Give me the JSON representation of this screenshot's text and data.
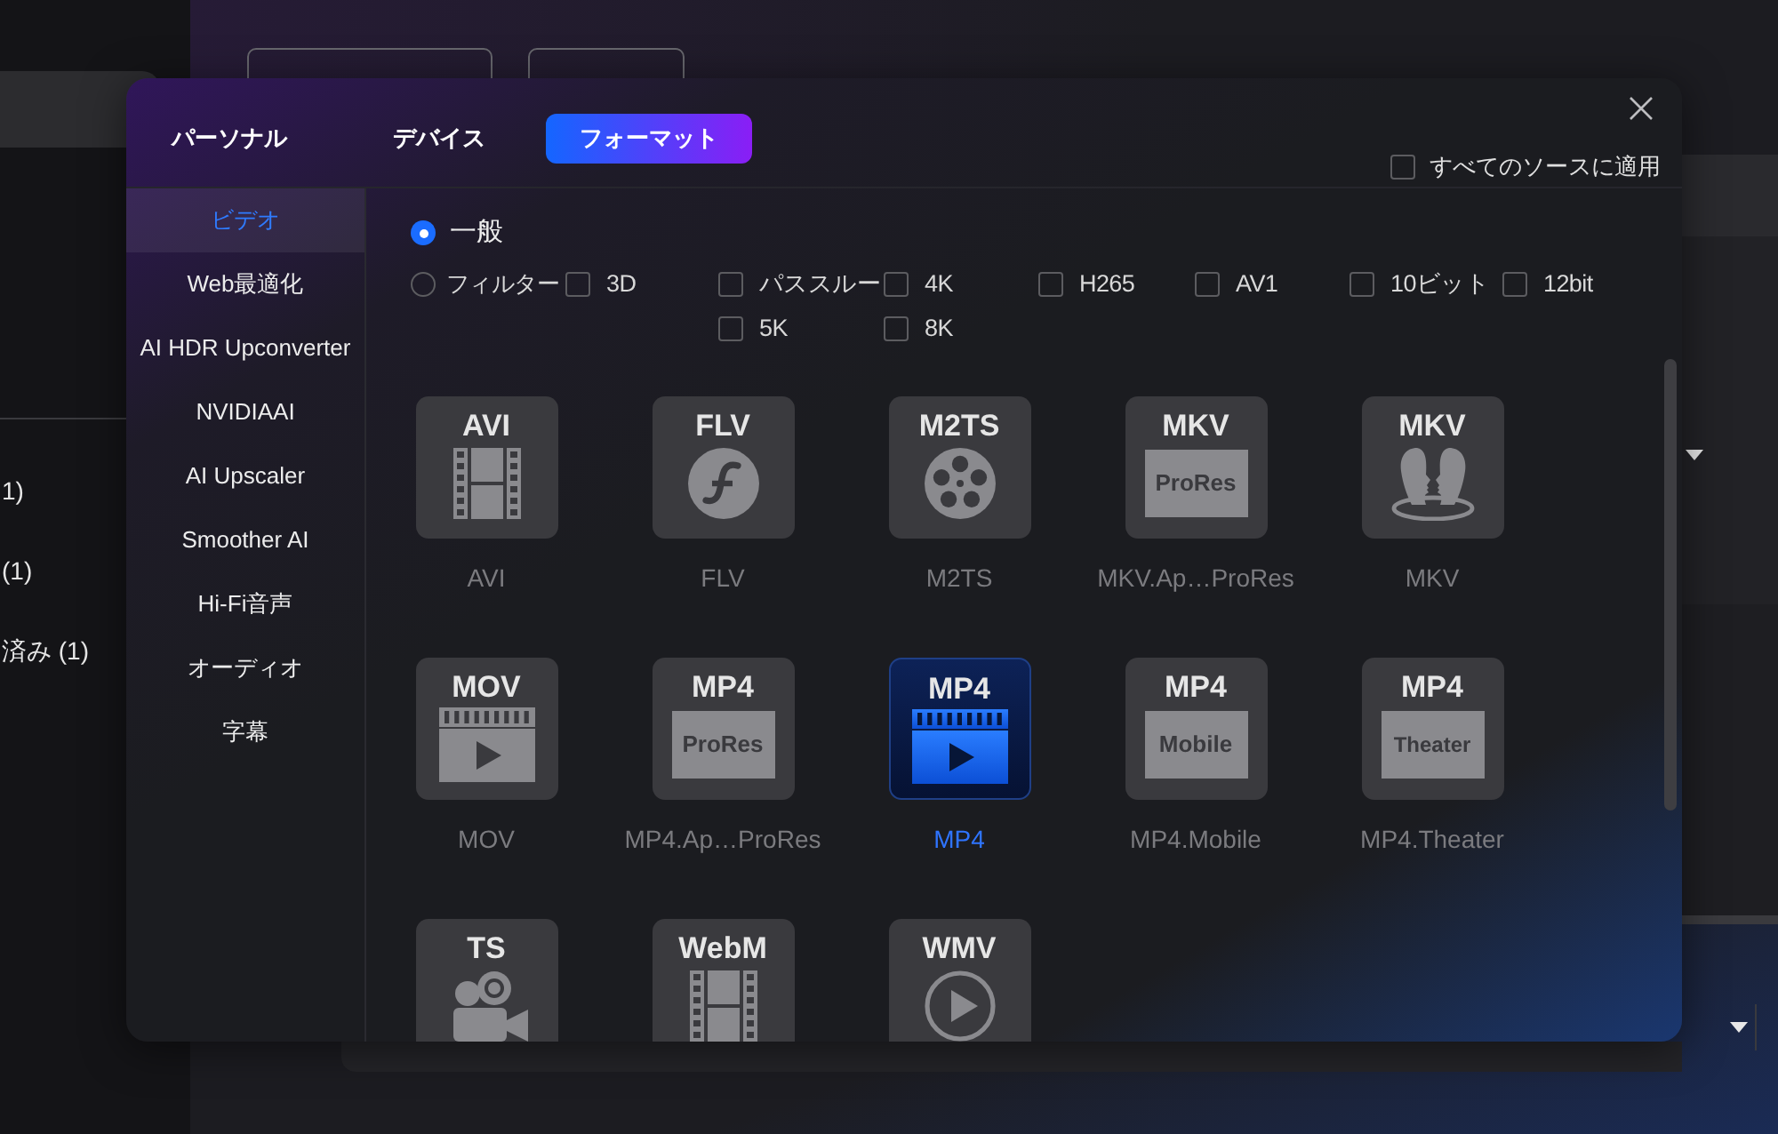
{
  "background": {
    "side_counts": [
      "1)",
      "(1)",
      "済み (1)"
    ]
  },
  "dialog": {
    "tabs": [
      {
        "label": "パーソナル",
        "selected": false
      },
      {
        "label": "デバイス",
        "selected": false
      },
      {
        "label": "フォーマット",
        "selected": true
      }
    ],
    "apply_all": {
      "label": "すべてのソースに適用",
      "checked": false
    },
    "sidebar": {
      "items": [
        {
          "label": "ビデオ",
          "selected": true
        },
        {
          "label": "Web最適化",
          "selected": false
        },
        {
          "label": "AI HDR Upconverter",
          "selected": false
        },
        {
          "label": "NVIDIAAI",
          "selected": false
        },
        {
          "label": "AI Upscaler",
          "selected": false
        },
        {
          "label": "Smoother AI",
          "selected": false
        },
        {
          "label": "Hi-Fi音声",
          "selected": false
        },
        {
          "label": "オーディオ",
          "selected": false
        },
        {
          "label": "字幕",
          "selected": false
        }
      ]
    },
    "modes": [
      {
        "label": "一般",
        "selected": true
      },
      {
        "label": "フィルター",
        "selected": false
      }
    ],
    "filters": [
      {
        "label": "3D",
        "checked": false
      },
      {
        "label": "パススルー",
        "checked": false
      },
      {
        "label": "4K",
        "checked": false
      },
      {
        "label": "H265",
        "checked": false
      },
      {
        "label": "AV1",
        "checked": false
      },
      {
        "label": "10ビット",
        "checked": false
      },
      {
        "label": "12bit",
        "checked": false
      },
      {
        "label": "5K",
        "checked": false
      },
      {
        "label": "8K",
        "checked": false
      }
    ],
    "formats": [
      {
        "badge": "AVI",
        "kind": "film",
        "label": "AVI",
        "selected": false
      },
      {
        "badge": "FLV",
        "kind": "f-circle",
        "label": "FLV",
        "selected": false
      },
      {
        "badge": "M2TS",
        "kind": "reel",
        "label": "M2TS",
        "selected": false
      },
      {
        "badge": "MKV",
        "kind": "tag",
        "tag": "ProRes",
        "label": "MKV.Ap…ProRes",
        "selected": false
      },
      {
        "badge": "MKV",
        "kind": "profiles",
        "label": "MKV",
        "selected": false
      },
      {
        "badge": "MOV",
        "kind": "clapper",
        "label": "MOV",
        "selected": false
      },
      {
        "badge": "MP4",
        "kind": "tag",
        "tag": "ProRes",
        "label": "MP4.Ap…ProRes",
        "selected": false
      },
      {
        "badge": "MP4",
        "kind": "clapper",
        "label": "MP4",
        "selected": true
      },
      {
        "badge": "MP4",
        "kind": "tag",
        "tag": "Mobile",
        "label": "MP4.Mobile",
        "selected": false
      },
      {
        "badge": "MP4",
        "kind": "tag",
        "tag": "Theater",
        "label": "MP4.Theater",
        "selected": false
      },
      {
        "badge": "TS",
        "kind": "camera",
        "selected": false
      },
      {
        "badge": "WebM",
        "kind": "film",
        "selected": false
      },
      {
        "badge": "WMV",
        "kind": "play-circle",
        "selected": false
      }
    ]
  }
}
